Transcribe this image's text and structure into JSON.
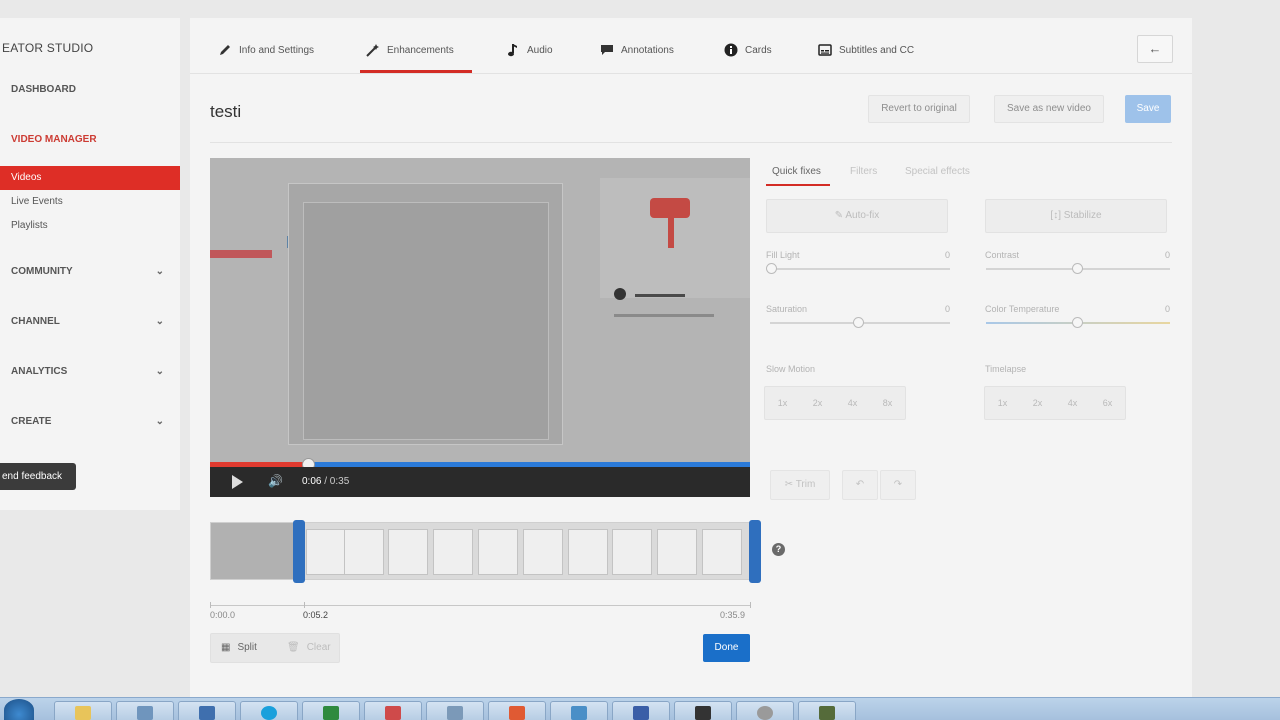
{
  "sidebar": {
    "brand": "EATOR STUDIO",
    "dashboard": "DASHBOARD",
    "video_manager": "VIDEO MANAGER",
    "videos": "Videos",
    "live_events": "Live Events",
    "playlists": "Playlists",
    "community": "COMMUNITY",
    "channel": "CHANNEL",
    "analytics": "ANALYTICS",
    "create": "CREATE",
    "feedback": "end feedback"
  },
  "tabs": {
    "info": "Info and Settings",
    "enhancements": "Enhancements",
    "audio": "Audio",
    "annotations": "Annotations",
    "cards": "Cards",
    "subtitles": "Subtitles and CC"
  },
  "title": "testi",
  "actions": {
    "revert": "Revert to original",
    "save_as_new": "Save as new video",
    "save": "Save"
  },
  "player": {
    "current_time": "0:06",
    "duration": "/ 0:35",
    "progress_fraction": 0.18
  },
  "enhance": {
    "subtabs": [
      "Quick fixes",
      "Filters",
      "Special effects"
    ],
    "auto_fix": "Auto-fix",
    "stabilize": "Stabilize",
    "fill_light": "Fill Light",
    "fill_light_value": "0",
    "contrast": "Contrast",
    "contrast_value": "0",
    "saturation": "Saturation",
    "saturation_value": "0",
    "color_temp": "Color Temperature",
    "color_temp_value": "0",
    "slow_motion": "Slow Motion",
    "slow_options": [
      "1x",
      "2x",
      "4x",
      "8x"
    ],
    "timelapse": "Timelapse",
    "timelapse_options": [
      "1x",
      "2x",
      "4x",
      "6x"
    ],
    "trim": "Trim"
  },
  "trim": {
    "start_label": "0:00.0",
    "cursor_label": "0:05.2",
    "end_label": "0:35.9",
    "split": "Split",
    "clear": "Clear",
    "done": "Done"
  }
}
